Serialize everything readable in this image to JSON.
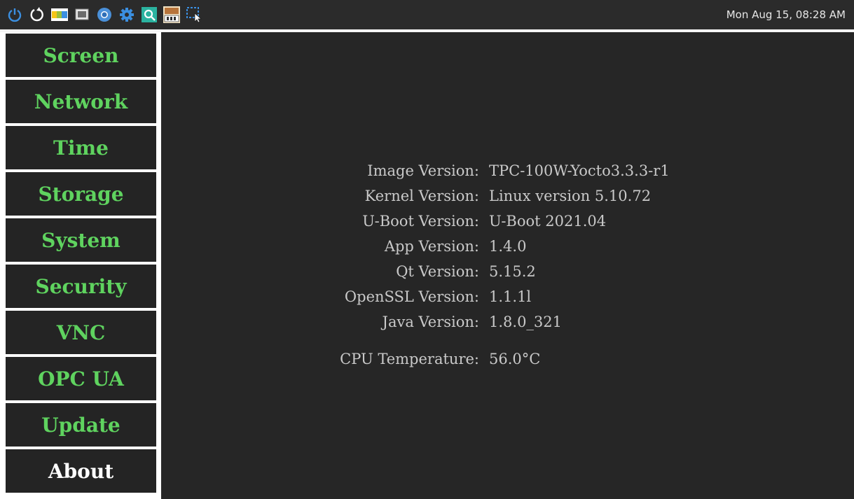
{
  "taskbar": {
    "icons": [
      {
        "name": "power-icon",
        "color": "#3b8fe0"
      },
      {
        "name": "restart-icon",
        "color": "#ffffff"
      },
      {
        "name": "nxp-logo-icon",
        "color": "#f5c518"
      },
      {
        "name": "display-icon",
        "color": "#d0d0d0"
      },
      {
        "name": "chromium-icon",
        "color": "#4a90d9"
      },
      {
        "name": "settings-gear-icon",
        "color": "#3b8fe0"
      },
      {
        "name": "search-app-icon",
        "color": "#2bb3a0"
      },
      {
        "name": "vnc-icon",
        "color": "#b8743a"
      },
      {
        "name": "screenshot-icon",
        "color": "#3b8fe0"
      }
    ],
    "clock": "Mon Aug 15, 08:28 AM"
  },
  "sidebar": {
    "items": [
      {
        "label": "Screen",
        "active": false
      },
      {
        "label": "Network",
        "active": false
      },
      {
        "label": "Time",
        "active": false
      },
      {
        "label": "Storage",
        "active": false
      },
      {
        "label": "System",
        "active": false
      },
      {
        "label": "Security",
        "active": false
      },
      {
        "label": "VNC",
        "active": false
      },
      {
        "label": "OPC UA",
        "active": false
      },
      {
        "label": "Update",
        "active": false
      },
      {
        "label": "About",
        "active": true
      }
    ],
    "accent_color": "#5fd35f",
    "active_color": "#ffffff"
  },
  "about": {
    "rows": [
      {
        "key": "Image Version:",
        "value": "TPC-100W-Yocto3.3.3-r1"
      },
      {
        "key": "Kernel Version:",
        "value": "Linux version 5.10.72"
      },
      {
        "key": "U-Boot Version:",
        "value": "U-Boot 2021.04"
      },
      {
        "key": "App Version:",
        "value": "1.4.0"
      },
      {
        "key": "Qt Version:",
        "value": "5.15.2"
      },
      {
        "key": "OpenSSL Version:",
        "value": "1.1.1l"
      },
      {
        "key": "Java Version:",
        "value": "1.8.0_321"
      },
      {
        "key": "CPU Temperature:",
        "value": "56.0°C"
      }
    ]
  }
}
